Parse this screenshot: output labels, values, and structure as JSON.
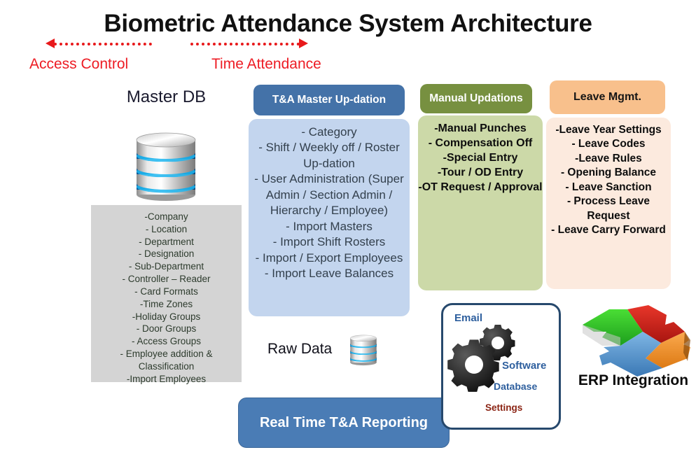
{
  "title": "Biometric Attendance System Architecture",
  "flow_labels": {
    "left": "Access Control",
    "right": "Time Attendance"
  },
  "colors": {
    "title_text": "#111111",
    "arrow_red": "#e8191b",
    "label_red": "#ed1c24",
    "blue_header": "#4472a8",
    "blue_body": "#c3d5ee",
    "green_header": "#779040",
    "green_body": "#ccd9a8",
    "orange_header": "#f8c08c",
    "orange_body": "#fceade",
    "grey_body": "#d4d4d4",
    "realtime_bar": "#4a7cb5",
    "gears_border": "#27496d",
    "gear_label_blue": "#2e5f9e",
    "settings_red": "#8b2414"
  },
  "master_db": {
    "title": "Master DB",
    "icon": "database-cylinder-icon",
    "items": [
      "-Company",
      "- Location",
      "- Department",
      "- Designation",
      "- Sub-Department",
      "- Controller – Reader",
      "- Card Formats",
      "-Time Zones",
      "-Holiday Groups",
      "- Door Groups",
      "- Access Groups",
      "- Employee addition & Classification",
      "-Import Employees"
    ]
  },
  "tna_master": {
    "header": "T&A Master Up-dation",
    "items": [
      "- Category",
      "- Shift / Weekly off  / Roster Up-dation",
      "- User Administration (Super Admin / Section Admin / Hierarchy / Employee)",
      "- Import Masters",
      "- Import Shift Rosters",
      "- Import / Export Employees",
      "- Import Leave Balances"
    ]
  },
  "manual_updations": {
    "header": "Manual Updations",
    "items": [
      "-Manual Punches",
      "- Compensation Off",
      "-Special Entry",
      "-Tour / OD Entry",
      "-OT Request / Approval"
    ]
  },
  "leave_mgmt": {
    "header": "Leave Mgmt.",
    "items": [
      "-Leave Year Settings",
      "- Leave Codes",
      "-Leave Rules",
      "- Opening Balance",
      "- Leave Sanction",
      "- Process Leave Request",
      "- Leave Carry Forward"
    ]
  },
  "raw_data": {
    "label": "Raw Data",
    "icon": "database-cylinder-icon"
  },
  "realtime": {
    "label": "Real Time T&A Reporting"
  },
  "settings_box": {
    "email": "Email",
    "software": "Software",
    "database": "Database",
    "settings": "Settings",
    "icon": "gears-icon"
  },
  "erp": {
    "label": "ERP Integration",
    "icon": "puzzle-pieces-icon",
    "piece_colors": [
      "#2db82d",
      "#d4271e",
      "#f0962e",
      "#5b9bd5"
    ]
  }
}
